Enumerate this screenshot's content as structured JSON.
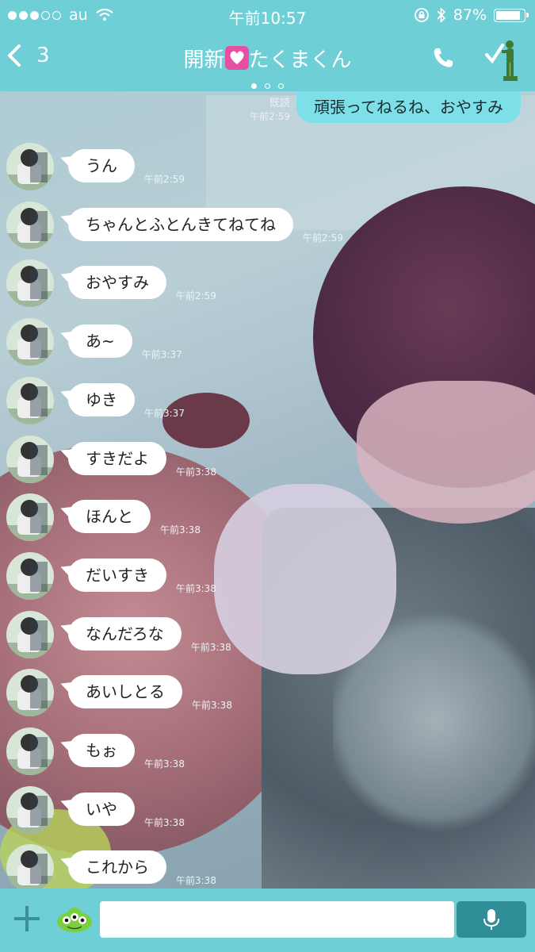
{
  "status_bar": {
    "carrier": "au",
    "time": "午前10:57",
    "battery": "87%",
    "battery_level": 0.87
  },
  "header": {
    "back_count": "3",
    "title_prefix": "開新",
    "title_suffix": "たくまくん",
    "page_count": 3,
    "page_active": 0
  },
  "sent_message": {
    "read_label": "既読",
    "time": "午前2:59",
    "text": "頑張ってねるね、おやすみ"
  },
  "messages": [
    {
      "text": "うん",
      "time": "午前2:59"
    },
    {
      "text": "ちゃんとふとんきてねてね",
      "time": "午前2:59"
    },
    {
      "text": "おやすみ",
      "time": "午前2:59"
    },
    {
      "text": "あ~",
      "time": "午前3:37"
    },
    {
      "text": "ゆき",
      "time": "午前3:37"
    },
    {
      "text": "すきだよ",
      "time": "午前3:38"
    },
    {
      "text": "ほんと",
      "time": "午前3:38"
    },
    {
      "text": "だいすき",
      "time": "午前3:38"
    },
    {
      "text": "なんだろな",
      "time": "午前3:38"
    },
    {
      "text": "あいしとる",
      "time": "午前3:38"
    },
    {
      "text": "もぉ",
      "time": "午前3:38"
    },
    {
      "text": "いや",
      "time": "午前3:38"
    },
    {
      "text": "これから",
      "time": "午前3:38"
    }
  ],
  "input_bar": {
    "placeholder": ""
  },
  "icons": {
    "back": "chevron-left-icon",
    "call": "phone-icon",
    "notes": "toy-soldier-icon",
    "plus": "plus-icon",
    "sticker": "alien-sticker-icon",
    "mic": "microphone-icon"
  },
  "colors": {
    "header": "#6fcfd6",
    "sent_bubble": "#7de0e8",
    "received_bubble": "#ffffff",
    "mic_button": "#2f8f98"
  }
}
